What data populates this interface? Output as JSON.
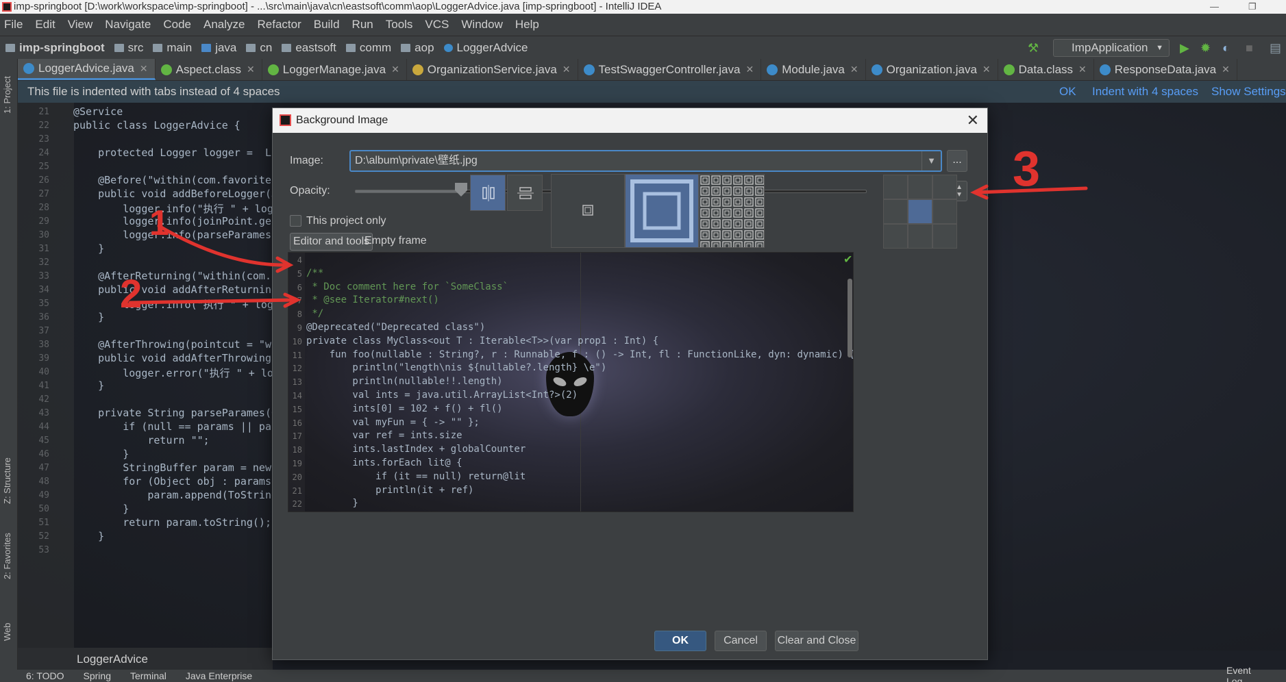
{
  "window": {
    "title": "imp-springboot [D:\\work\\workspace\\imp-springboot] - ...\\src\\main\\java\\cn\\eastsoft\\comm\\aop\\LoggerAdvice.java [imp-springboot] - IntelliJ IDEA"
  },
  "menu": [
    "File",
    "Edit",
    "View",
    "Navigate",
    "Code",
    "Analyze",
    "Refactor",
    "Build",
    "Run",
    "Tools",
    "VCS",
    "Window",
    "Help"
  ],
  "nav": {
    "crumbs": [
      "imp-springboot",
      "src",
      "main",
      "java",
      "cn",
      "eastsoft",
      "comm",
      "aop",
      "LoggerAdvice"
    ],
    "run_config": "ImpApplication"
  },
  "tabs": [
    {
      "label": "LoggerAdvice.java",
      "icon": "class-icon"
    },
    {
      "label": "Aspect.class",
      "icon": "annotation-icon"
    },
    {
      "label": "LoggerManage.java",
      "icon": "annotation-icon"
    },
    {
      "label": "OrganizationService.java",
      "icon": "interface-icon"
    },
    {
      "label": "TestSwaggerController.java",
      "icon": "class-icon"
    },
    {
      "label": "Module.java",
      "icon": "class-icon"
    },
    {
      "label": "Organization.java",
      "icon": "class-icon"
    },
    {
      "label": "Data.class",
      "icon": "annotation-icon"
    },
    {
      "label": "ResponseData.java",
      "icon": "class-icon"
    }
  ],
  "notice": {
    "text": "This file is indented with tabs instead of 4 spaces",
    "ok": "OK",
    "indent": "Indent with 4 spaces",
    "settings": "Show Settings"
  },
  "toolwindows": {
    "project": "1: Project",
    "structure": "Z: Structure",
    "favorites": "2: Favorites",
    "web": "Web"
  },
  "editor": {
    "lines": [
      {
        "n": "21",
        "t": "@Service"
      },
      {
        "n": "22",
        "t": "public class LoggerAdvice {"
      },
      {
        "n": "23",
        "t": ""
      },
      {
        "n": "24",
        "t": "    protected Logger logger =  Logge"
      },
      {
        "n": "25",
        "t": ""
      },
      {
        "n": "26",
        "t": "    @Before(\"within(com.favorites..*"
      },
      {
        "n": "27",
        "t": "    public void addBeforeLogger(Join"
      },
      {
        "n": "28",
        "t": "        logger.info(\"执行 \" + loggerM"
      },
      {
        "n": "29",
        "t": "        logger.info(joinPoint.getSig"
      },
      {
        "n": "30",
        "t": "        logger.info(parseParames(joi"
      },
      {
        "n": "31",
        "t": "    }"
      },
      {
        "n": "32",
        "t": ""
      },
      {
        "n": "33",
        "t": "    @AfterReturning(\"within(com.favo"
      },
      {
        "n": "34",
        "t": "    public void addAfterReturningLog"
      },
      {
        "n": "35",
        "t": "        logger.info(\"执行 \" + loggerM"
      },
      {
        "n": "36",
        "t": "    }"
      },
      {
        "n": "37",
        "t": ""
      },
      {
        "n": "38",
        "t": "    @AfterThrowing(pointcut = \"withi"
      },
      {
        "n": "39",
        "t": "    public void addAfterThrowingLogge"
      },
      {
        "n": "40",
        "t": "        logger.error(\"执行 \" + logger"
      },
      {
        "n": "41",
        "t": "    }"
      },
      {
        "n": "42",
        "t": ""
      },
      {
        "n": "43",
        "t": "    private String parseParames(Obje"
      },
      {
        "n": "44",
        "t": "        if (null == params || parame"
      },
      {
        "n": "45",
        "t": "            return \"\";"
      },
      {
        "n": "46",
        "t": "        }"
      },
      {
        "n": "47",
        "t": "        StringBuffer param = new Str"
      },
      {
        "n": "48",
        "t": "        for (Object obj : params) {"
      },
      {
        "n": "49",
        "t": "            param.append(ToStringBuil"
      },
      {
        "n": "50",
        "t": "        }"
      },
      {
        "n": "51",
        "t": "        return param.toString();"
      },
      {
        "n": "52",
        "t": "    }"
      },
      {
        "n": "53",
        "t": ""
      }
    ],
    "footer_breadcrumb": "LoggerAdvice"
  },
  "bottom_tools": [
    "6: TODO",
    "Spring",
    "Terminal",
    "Java Enterprise"
  ],
  "bottom_right": "Event Log",
  "dialog": {
    "title": "Background Image",
    "image_label": "Image:",
    "image_value": "D:\\album\\private\\壁纸.jpg",
    "browse": "...",
    "opacity_label": "Opacity:",
    "opacity_value": "25",
    "opacity_percent": 25,
    "this_project_only": "This project only",
    "target_selected": "Editor and tools",
    "target_other": "Empty frame",
    "preview_lines": [
      {
        "n": "4",
        "t": ""
      },
      {
        "n": "5",
        "t": "/**"
      },
      {
        "n": "6",
        "t": " * Doc comment here for `SomeClass`"
      },
      {
        "n": "7",
        "t": " * @see Iterator#next()"
      },
      {
        "n": "8",
        "t": " */"
      },
      {
        "n": "9",
        "t": "@Deprecated(\"Deprecated class\")"
      },
      {
        "n": "10",
        "t": "private class MyClass<out T : Iterable<T>>(var prop1 : Int) {"
      },
      {
        "n": "11",
        "t": "    fun foo(nullable : String?, r : Runnable, f : () -> Int, fl : FunctionLike, dyn: dynamic) {"
      },
      {
        "n": "12",
        "t": "        println(\"length\\nis ${nullable?.length} \\e\")"
      },
      {
        "n": "13",
        "t": "        println(nullable!!.length)"
      },
      {
        "n": "14",
        "t": "        val ints = java.util.ArrayList<Int?>(2)"
      },
      {
        "n": "15",
        "t": "        ints[0] = 102 + f() + fl()"
      },
      {
        "n": "16",
        "t": "        val myFun = { -> \"\" };"
      },
      {
        "n": "17",
        "t": "        var ref = ints.size"
      },
      {
        "n": "18",
        "t": "        ints.lastIndex + globalCounter"
      },
      {
        "n": "19",
        "t": "        ints.forEach lit@ {"
      },
      {
        "n": "20",
        "t": "            if (it == null) return@lit"
      },
      {
        "n": "21",
        "t": "            println(it + ref)"
      },
      {
        "n": "22",
        "t": "        }"
      }
    ],
    "ok": "OK",
    "cancel": "Cancel",
    "clear_close": "Clear and Close"
  },
  "annotations": [
    "1",
    "2",
    "3"
  ],
  "colors": {
    "accent": "#4a88c7",
    "annotation": "#e0332e"
  }
}
